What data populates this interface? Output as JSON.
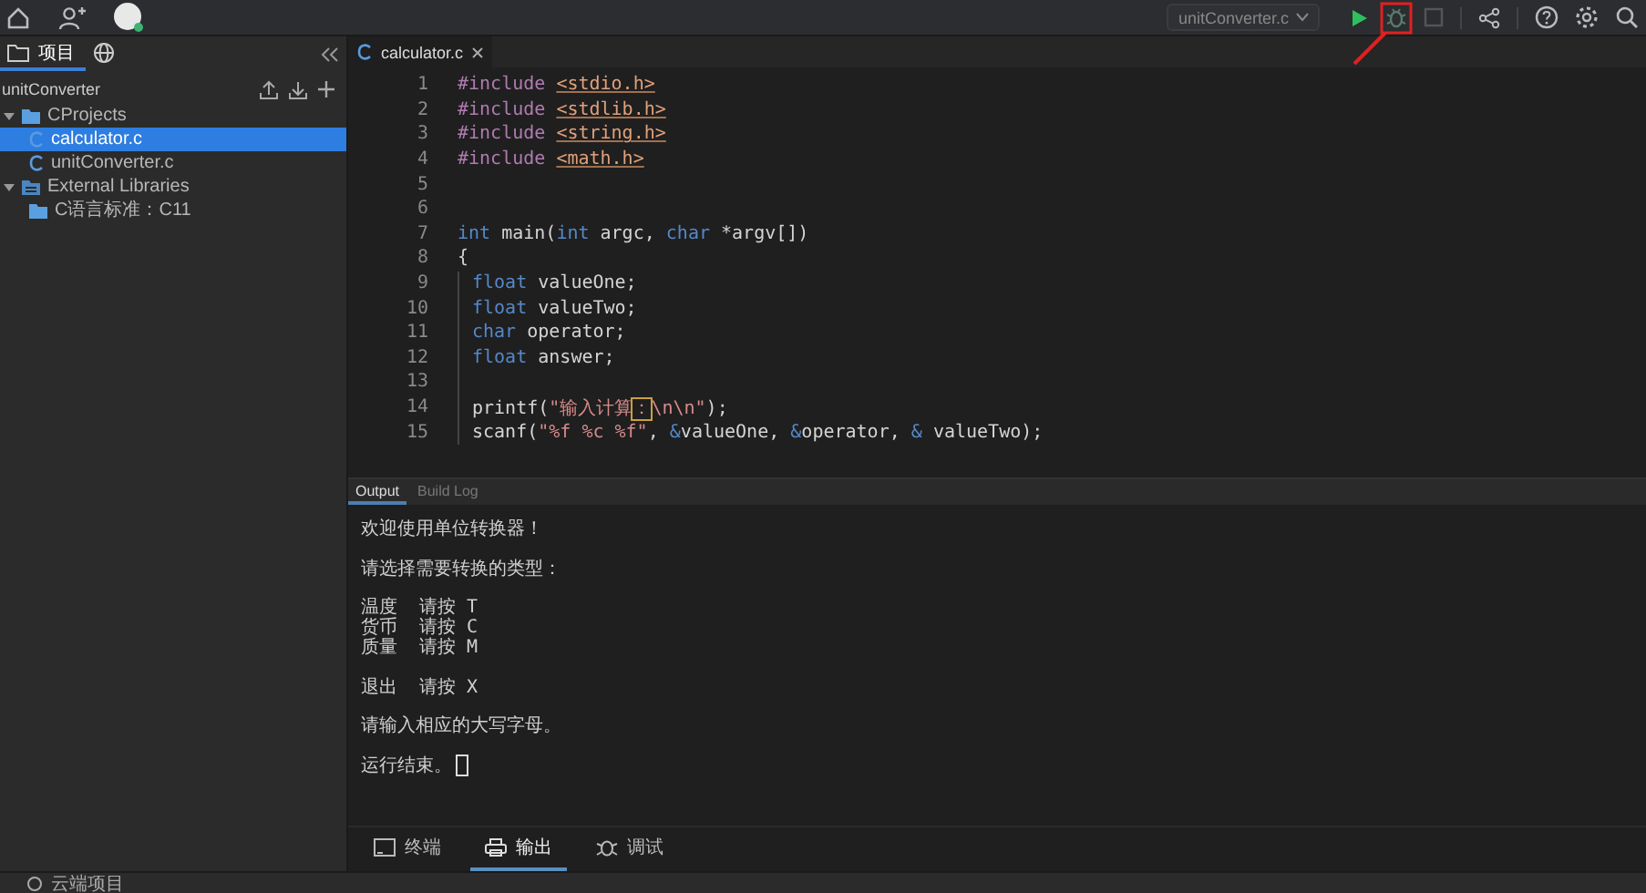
{
  "toolbar": {
    "run_target": "unitConverter.c"
  },
  "sidebar": {
    "tabs": [
      {
        "label": "项目",
        "selected": true
      },
      {
        "kind": "globe",
        "selected": false
      }
    ],
    "project": "unitConverter",
    "tree": [
      {
        "label": "CProjects",
        "kind": "folder",
        "expanded": true,
        "selected": false,
        "children": [
          {
            "label": "calculator.c",
            "kind": "file",
            "selected": true
          },
          {
            "label": "unitConverter.c",
            "kind": "file",
            "selected": false
          }
        ]
      },
      {
        "label": "External Libraries",
        "kind": "library",
        "expanded": true,
        "selected": false,
        "children": [
          {
            "label": "C语言标准：C11",
            "kind": "folder",
            "selected": false
          }
        ]
      }
    ]
  },
  "editor": {
    "tabs": [
      {
        "label": "calculator.c",
        "selected": true
      }
    ],
    "lines": [
      {
        "number": "1",
        "tokens": [
          {
            "kind": "directive",
            "text": "#include "
          },
          {
            "kind": "header",
            "text": "<stdio.h>"
          }
        ]
      },
      {
        "number": "2",
        "tokens": [
          {
            "kind": "directive",
            "text": "#include "
          },
          {
            "kind": "header",
            "text": "<stdlib.h>"
          }
        ]
      },
      {
        "number": "3",
        "tokens": [
          {
            "kind": "directive",
            "text": "#include "
          },
          {
            "kind": "header",
            "text": "<string.h>"
          }
        ]
      },
      {
        "number": "4",
        "tokens": [
          {
            "kind": "directive",
            "text": "#include "
          },
          {
            "kind": "header",
            "text": "<math.h>"
          }
        ]
      },
      {
        "number": "5"
      },
      {
        "number": "6"
      },
      {
        "number": "7",
        "tokens": [
          {
            "kind": "keyword",
            "text": "int"
          },
          {
            "kind": "plain",
            "text": " main("
          },
          {
            "kind": "keyword",
            "text": "int"
          },
          {
            "kind": "plain",
            "text": " argc, "
          },
          {
            "kind": "keyword",
            "text": "char"
          },
          {
            "kind": "plain",
            "text": " *argv[])"
          }
        ]
      },
      {
        "number": "8",
        "tokens": [
          {
            "kind": "plain",
            "text": "{"
          }
        ]
      },
      {
        "number": "9",
        "indented": true,
        "tokens": [
          {
            "kind": "keyword",
            "text": "float"
          },
          {
            "kind": "plain",
            "text": " valueOne;"
          }
        ]
      },
      {
        "number": "10",
        "indented": true,
        "tokens": [
          {
            "kind": "keyword",
            "text": "float"
          },
          {
            "kind": "plain",
            "text": " valueTwo;"
          }
        ]
      },
      {
        "number": "11",
        "indented": true,
        "tokens": [
          {
            "kind": "keyword",
            "text": "char"
          },
          {
            "kind": "plain",
            "text": " operator;"
          }
        ]
      },
      {
        "number": "12",
        "indented": true,
        "tokens": [
          {
            "kind": "keyword",
            "text": "float"
          },
          {
            "kind": "plain",
            "text": " answer;"
          }
        ]
      },
      {
        "number": "13",
        "indented": true
      },
      {
        "number": "14",
        "indented": true,
        "tokens": [
          {
            "kind": "plain",
            "text": "printf("
          },
          {
            "kind": "string",
            "text": "\"输入计算"
          },
          {
            "kind": "warning",
            "text": "："
          },
          {
            "kind": "string",
            "text": "\\n\\n\""
          },
          {
            "kind": "plain",
            "text": ");"
          }
        ]
      },
      {
        "number": "15",
        "indented": true,
        "tokens": [
          {
            "kind": "plain",
            "text": "scanf("
          },
          {
            "kind": "string",
            "text": "\"%f %c %f\""
          },
          {
            "kind": "plain",
            "text": ", "
          },
          {
            "kind": "operator",
            "text": "&"
          },
          {
            "kind": "plain",
            "text": "valueOne, "
          },
          {
            "kind": "operator",
            "text": "&"
          },
          {
            "kind": "plain",
            "text": "operator, "
          },
          {
            "kind": "operator",
            "text": "&"
          },
          {
            "kind": "plain",
            "text": " valueTwo);"
          }
        ]
      }
    ]
  },
  "output": {
    "tabs": [
      {
        "label": "Output",
        "selected": true
      },
      {
        "label": "Build Log",
        "selected": false
      }
    ],
    "blocks": [
      [
        "欢迎使用单位转换器！"
      ],
      [
        "请选择需要转换的类型："
      ],
      [
        "温度  请按 T",
        "货币  请按 C",
        "质量  请按 M"
      ],
      [
        "退出  请按 X"
      ],
      [
        "请输入相应的大写字母。"
      ],
      [
        "运行结束。"
      ]
    ],
    "cursor": true
  },
  "bottom_tabs": [
    {
      "label": "终端",
      "kind": "terminal",
      "selected": false
    },
    {
      "label": "输出",
      "kind": "printer",
      "selected": true
    },
    {
      "label": "调试",
      "kind": "bug",
      "selected": false
    }
  ],
  "status_bar": {
    "label": "云端项目"
  }
}
